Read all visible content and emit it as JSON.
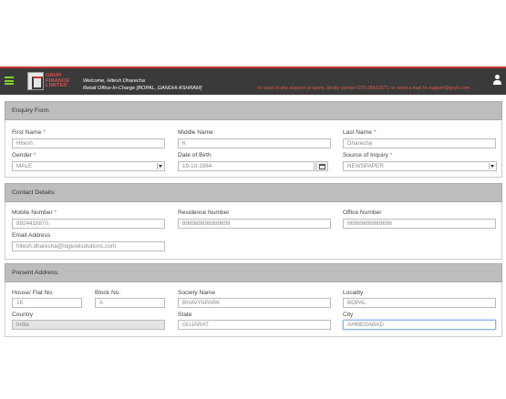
{
  "header": {
    "logo_line1": "GRUH",
    "logo_line2": "FINANCE",
    "logo_line3": "LIMITED",
    "welcome": "Welcome, Hitesh Dharecha",
    "office": "Retail Office-In-Charge [BOPAL, GANDHI ASHRAM]",
    "support": "In case of any support or query, kindly contact 079-28421671, or send a mail to support@gruh.com",
    "accent_color": "#c0392b",
    "menu_icon": "hamburger-menu-icon",
    "user_icon": "user-icon"
  },
  "enquiry": {
    "title": "Enquiry Form",
    "first_name": {
      "label": "First Name",
      "required": "*",
      "value": "Hitesh"
    },
    "middle_name": {
      "label": "Middle Name",
      "value": "K"
    },
    "last_name": {
      "label": "Last Name",
      "required": "*",
      "value": "Dharecha"
    },
    "gender": {
      "label": "Gender",
      "required": "*",
      "value": "MALE"
    },
    "dob": {
      "label": "Date of Birth",
      "value": "19-10-1984"
    },
    "source": {
      "label": "Source of Inquiry",
      "required": "*",
      "value": "NEWSPAPER"
    }
  },
  "contact": {
    "title": "Contact Details:",
    "mobile": {
      "label": "Mobile Number",
      "required": "*",
      "value": "9924418870."
    },
    "residence": {
      "label": "Residence Number",
      "value": "898989898989899"
    },
    "office": {
      "label": "Office Number",
      "value": "96969696969696"
    },
    "email": {
      "label": "Email Address",
      "value": "hitesh.dharecha@logicielsolutions.com"
    }
  },
  "address": {
    "title": "Present Address:",
    "house": {
      "label": "House/ Flat No.",
      "value": "16"
    },
    "block": {
      "label": "Block No.",
      "value": "A"
    },
    "society": {
      "label": "Society Name",
      "value": "BHAVYAPARK"
    },
    "locality": {
      "label": "Locality",
      "value": "BOPAL"
    },
    "country": {
      "label": "Country",
      "value": "India"
    },
    "state": {
      "label": "State",
      "value": "GUJARAT"
    },
    "city": {
      "label": "City",
      "value": "AHMEDABAD"
    }
  }
}
